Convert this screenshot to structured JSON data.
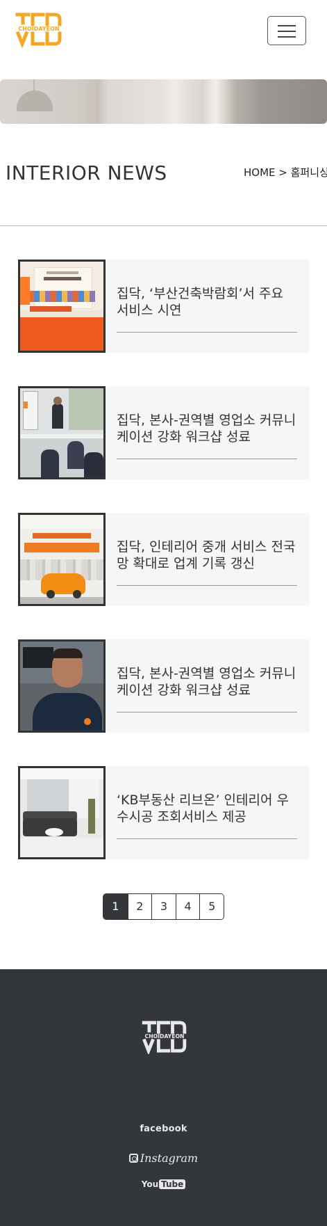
{
  "header": {
    "logo_text": "CHOIDAYEON",
    "menu_label": "menu"
  },
  "page": {
    "title": "INTERIOR NEWS",
    "breadcrumb": "HOME > 홈퍼니싱"
  },
  "news": [
    {
      "title": "집닥, ‘부산건축박람회’서 주요 서비스 시연",
      "thumb": "expo-booth"
    },
    {
      "title": "집닥, 본사-권역별 영업소 커뮤니케이션 강화 워크샵 성료",
      "thumb": "workshop"
    },
    {
      "title": "집닥, 인테리어 중개 서비스 전국망 확대로 업계 기록 갱신",
      "thumb": "service-car"
    },
    {
      "title": "집닥, 본사-권역별 영업소 커뮤니케이션 강화 워크샵 성료",
      "thumb": "portrait"
    },
    {
      "title": "‘KB부동산 리브온’ 인테리어 우수시공 조회서비스 제공",
      "thumb": "living-room"
    }
  ],
  "pagination": {
    "pages": [
      "1",
      "2",
      "3",
      "4",
      "5"
    ],
    "current": "1"
  },
  "footer": {
    "logo_text": "CHOIDAYEON",
    "facebook": "facebook",
    "instagram": "Instagram",
    "youtube_you": "You",
    "youtube_tube": "Tube"
  },
  "colors": {
    "logo_accent": "#f5a623",
    "footer_bg": "#33373b",
    "card_bg": "#f5f6f8",
    "active_page": "#33363b"
  }
}
